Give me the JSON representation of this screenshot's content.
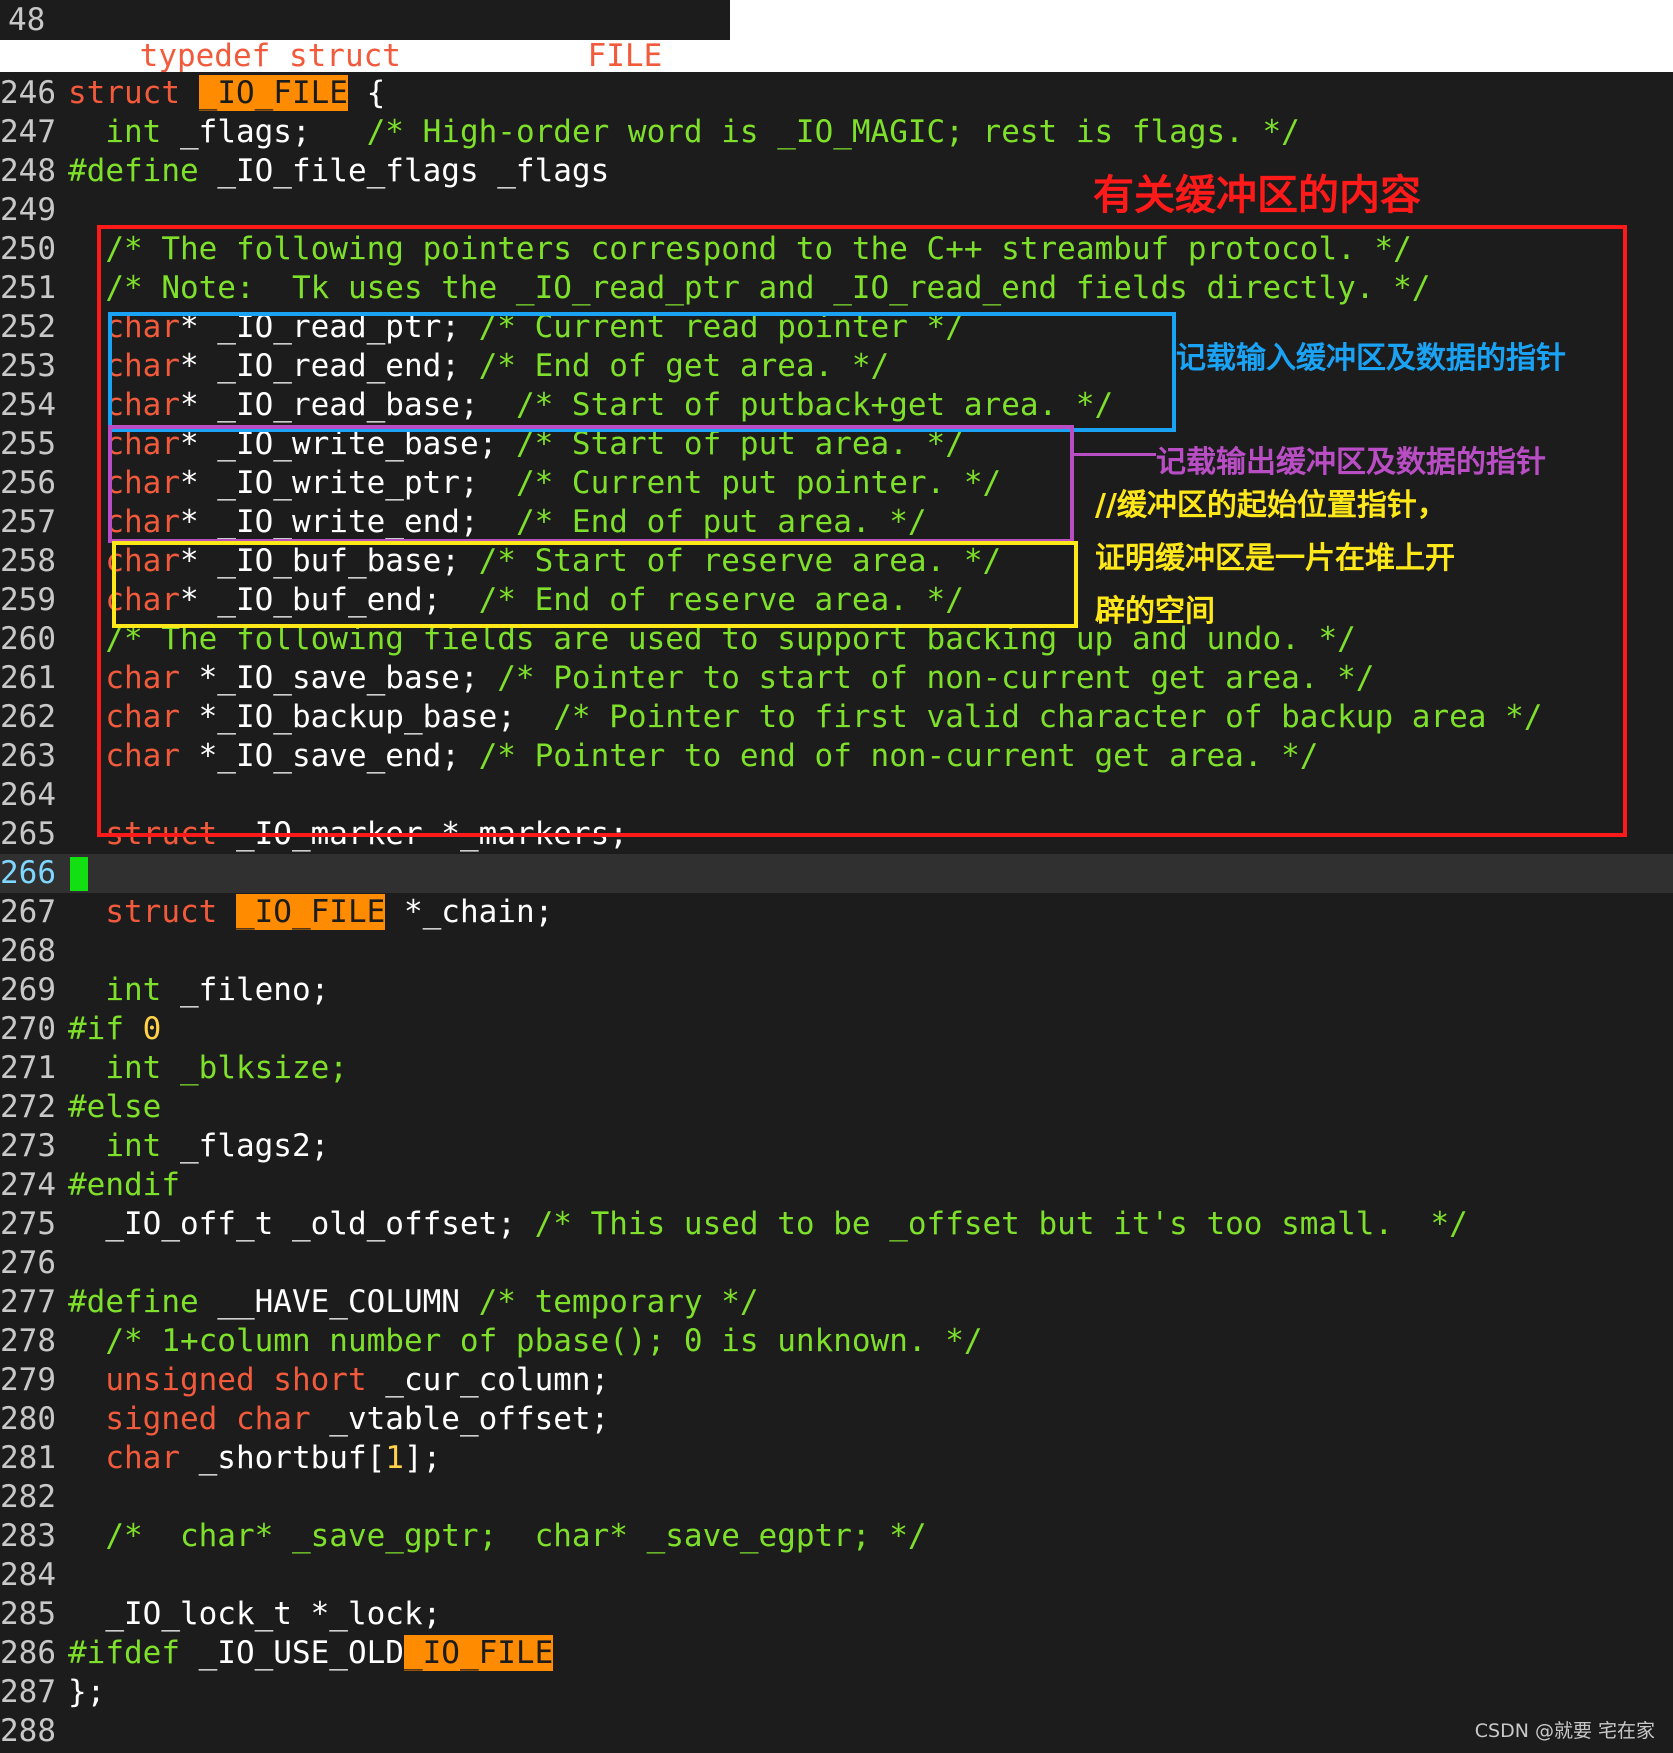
{
  "top_snippet": {
    "line_number": "48",
    "code": "typedef struct _IO_FILE FILE;"
  },
  "editor": {
    "lines": [
      {
        "n": "246",
        "tokens": [
          [
            "kw",
            "struct"
          ],
          [
            "id",
            " "
          ],
          [
            "hl",
            "_IO_FILE"
          ],
          [
            "id",
            " {"
          ]
        ]
      },
      {
        "n": "247",
        "tokens": [
          [
            "id",
            "  "
          ],
          [
            "cm",
            "int"
          ],
          [
            "id",
            " _flags;   "
          ],
          [
            "cm",
            "/* High-order word is _IO_MAGIC; rest is flags. */"
          ]
        ]
      },
      {
        "n": "248",
        "tokens": [
          [
            "pp",
            "#define"
          ],
          [
            "id",
            " _IO_file_flags _flags"
          ]
        ]
      },
      {
        "n": "249",
        "tokens": []
      },
      {
        "n": "250",
        "tokens": [
          [
            "id",
            "  "
          ],
          [
            "cm",
            "/* The following pointers correspond to the C++ streambuf protocol. */"
          ]
        ]
      },
      {
        "n": "251",
        "tokens": [
          [
            "id",
            "  "
          ],
          [
            "cm",
            "/* Note:  Tk uses the _IO_read_ptr and _IO_read_end fields directly. */"
          ]
        ]
      },
      {
        "n": "252",
        "tokens": [
          [
            "id",
            "  "
          ],
          [
            "kw",
            "char"
          ],
          [
            "id",
            "* _IO_read_ptr; "
          ],
          [
            "cm",
            "/* Current read pointer */"
          ]
        ]
      },
      {
        "n": "253",
        "tokens": [
          [
            "id",
            "  "
          ],
          [
            "kw",
            "char"
          ],
          [
            "id",
            "* _IO_read_end; "
          ],
          [
            "cm",
            "/* End of get area. */"
          ]
        ]
      },
      {
        "n": "254",
        "tokens": [
          [
            "id",
            "  "
          ],
          [
            "kw",
            "char"
          ],
          [
            "id",
            "* _IO_read_base;  "
          ],
          [
            "cm",
            "/* Start of putback+get area. */"
          ]
        ]
      },
      {
        "n": "255",
        "tokens": [
          [
            "id",
            "  "
          ],
          [
            "kw",
            "char"
          ],
          [
            "id",
            "* _IO_write_base; "
          ],
          [
            "cm",
            "/* Start of put area. */"
          ]
        ]
      },
      {
        "n": "256",
        "tokens": [
          [
            "id",
            "  "
          ],
          [
            "kw",
            "char"
          ],
          [
            "id",
            "* _IO_write_ptr;  "
          ],
          [
            "cm",
            "/* Current put pointer. */"
          ]
        ]
      },
      {
        "n": "257",
        "tokens": [
          [
            "id",
            "  "
          ],
          [
            "kw",
            "char"
          ],
          [
            "id",
            "* _IO_write_end;  "
          ],
          [
            "cm",
            "/* End of put area. */"
          ]
        ]
      },
      {
        "n": "258",
        "tokens": [
          [
            "id",
            "  "
          ],
          [
            "kw",
            "char"
          ],
          [
            "id",
            "* _IO_buf_base; "
          ],
          [
            "cm",
            "/* Start of reserve area. */"
          ]
        ]
      },
      {
        "n": "259",
        "tokens": [
          [
            "id",
            "  "
          ],
          [
            "kw",
            "char"
          ],
          [
            "id",
            "* _IO_buf_end;  "
          ],
          [
            "cm",
            "/* End of reserve area. */"
          ]
        ]
      },
      {
        "n": "260",
        "tokens": [
          [
            "id",
            "  "
          ],
          [
            "cm",
            "/* The following fields are used to support backing up and undo. */"
          ]
        ]
      },
      {
        "n": "261",
        "tokens": [
          [
            "id",
            "  "
          ],
          [
            "kw",
            "char"
          ],
          [
            "id",
            " *_IO_save_base; "
          ],
          [
            "cm",
            "/* Pointer to start of non-current get area. */"
          ]
        ]
      },
      {
        "n": "262",
        "tokens": [
          [
            "id",
            "  "
          ],
          [
            "kw",
            "char"
          ],
          [
            "id",
            " *_IO_backup_base;  "
          ],
          [
            "cm",
            "/* Pointer to first valid character of backup area */"
          ]
        ]
      },
      {
        "n": "263",
        "tokens": [
          [
            "id",
            "  "
          ],
          [
            "kw",
            "char"
          ],
          [
            "id",
            " *_IO_save_end; "
          ],
          [
            "cm",
            "/* Pointer to end of non-current get area. */"
          ]
        ]
      },
      {
        "n": "264",
        "tokens": []
      },
      {
        "n": "265",
        "tokens": [
          [
            "id",
            "  "
          ],
          [
            "kw",
            "struct"
          ],
          [
            "id",
            " _IO_marker *_markers;"
          ]
        ]
      },
      {
        "n": "266",
        "tokens": [],
        "current": true
      },
      {
        "n": "267",
        "tokens": [
          [
            "id",
            "  "
          ],
          [
            "kw",
            "struct"
          ],
          [
            "id",
            " "
          ],
          [
            "hl",
            "_IO_FILE"
          ],
          [
            "id",
            " *_chain;"
          ]
        ]
      },
      {
        "n": "268",
        "tokens": []
      },
      {
        "n": "269",
        "tokens": [
          [
            "id",
            "  "
          ],
          [
            "cm",
            "int"
          ],
          [
            "id",
            " _fileno;"
          ]
        ]
      },
      {
        "n": "270",
        "tokens": [
          [
            "pp",
            "#if"
          ],
          [
            "id",
            " "
          ],
          [
            "num",
            "0"
          ]
        ]
      },
      {
        "n": "271",
        "tokens": [
          [
            "id",
            "  "
          ],
          [
            "cm",
            "int"
          ],
          [
            "id",
            " "
          ],
          [
            "cm",
            "_blksize;"
          ]
        ]
      },
      {
        "n": "272",
        "tokens": [
          [
            "pp",
            "#else"
          ]
        ]
      },
      {
        "n": "273",
        "tokens": [
          [
            "id",
            "  "
          ],
          [
            "cm",
            "int"
          ],
          [
            "id",
            " _flags2;"
          ]
        ]
      },
      {
        "n": "274",
        "tokens": [
          [
            "pp",
            "#endif"
          ]
        ]
      },
      {
        "n": "275",
        "tokens": [
          [
            "id",
            "  _IO_off_t _old_offset; "
          ],
          [
            "cm",
            "/* This used to be _offset but it's too small.  */"
          ]
        ]
      },
      {
        "n": "276",
        "tokens": []
      },
      {
        "n": "277",
        "tokens": [
          [
            "pp",
            "#define"
          ],
          [
            "id",
            " __HAVE_COLUMN "
          ],
          [
            "cm",
            "/* temporary */"
          ]
        ]
      },
      {
        "n": "278",
        "tokens": [
          [
            "id",
            "  "
          ],
          [
            "cm",
            "/* 1+column number of pbase(); 0 is unknown. */"
          ]
        ]
      },
      {
        "n": "279",
        "tokens": [
          [
            "id",
            "  "
          ],
          [
            "kw",
            "unsigned short"
          ],
          [
            "id",
            " _cur_column;"
          ]
        ]
      },
      {
        "n": "280",
        "tokens": [
          [
            "id",
            "  "
          ],
          [
            "kw",
            "signed char"
          ],
          [
            "id",
            " _vtable_offset;"
          ]
        ]
      },
      {
        "n": "281",
        "tokens": [
          [
            "id",
            "  "
          ],
          [
            "kw",
            "char"
          ],
          [
            "id",
            " _shortbuf["
          ],
          [
            "num",
            "1"
          ],
          [
            "id",
            "];"
          ]
        ]
      },
      {
        "n": "282",
        "tokens": []
      },
      {
        "n": "283",
        "tokens": [
          [
            "id",
            "  "
          ],
          [
            "cm",
            "/*  char* _save_gptr;  char* _save_egptr; */"
          ]
        ]
      },
      {
        "n": "284",
        "tokens": []
      },
      {
        "n": "285",
        "tokens": [
          [
            "id",
            "  _IO_lock_t *_lock;"
          ]
        ]
      },
      {
        "n": "286",
        "tokens": [
          [
            "pp",
            "#ifdef"
          ],
          [
            "id",
            " _IO_USE_OLD"
          ],
          [
            "hl",
            "_IO_FILE"
          ]
        ]
      },
      {
        "n": "287",
        "tokens": [
          [
            "id",
            "};"
          ]
        ]
      },
      {
        "n": "288",
        "tokens": []
      }
    ]
  },
  "annotations": {
    "buffer_title": "有关缓冲区的内容",
    "read_note": "记载输入缓冲区及数据的指针",
    "write_note": "记载输出缓冲区及数据的指针",
    "buf_note_1": "//缓冲区的起始位置指针，",
    "buf_note_2": "证明缓冲区是一片在堆上开",
    "buf_note_3": "辟的空间"
  },
  "colors": {
    "background": "#1c1c1c",
    "keyword": "#f25a3c",
    "comment": "#7ee02a",
    "highlight": "#ff8c00",
    "red_box": "#ff1a1a",
    "blue_box": "#1aa3f5",
    "purple_box": "#b94dc4",
    "yellow_box": "#ffe81a",
    "cursor": "#13e013"
  },
  "watermark": "CSDN @就要 宅在家"
}
